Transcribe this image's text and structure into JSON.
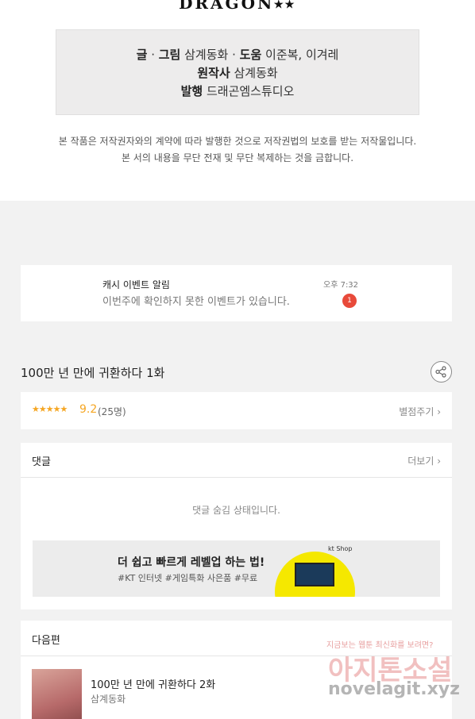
{
  "logo": "DRAGON⭑⭑",
  "credits": {
    "line1_label_a": "글",
    "sep1": " · ",
    "line1_label_b": "그림",
    "line1_name_a": " 삼계동화 · ",
    "line1_label_c": "도움",
    "line1_name_b": " 이준복, 이겨레",
    "line2_label": "원작사",
    "line2_name": " 삼계동화",
    "line3_label": "발행",
    "line3_name": " 드래곤엠스튜디오"
  },
  "notice": {
    "line1": "본 작품은 저작권자와의 계약에 따라 발행한 것으로 저작권법의 보호를 받는 저작물입니다.",
    "line2": "본 서의 내용을 무단 전재 및 무단 복제하는 것을 금합니다."
  },
  "alarm": {
    "title": "캐시 이벤트 알림",
    "desc": "이번주에 확인하지 못한 이벤트가 있습니다.",
    "time": "오후 7:32",
    "badge": "1"
  },
  "episode": {
    "title": "100만 년 만에 귀환하다 1화"
  },
  "rating": {
    "stars": "★★★★★",
    "score": "9.2",
    "count": "(25명)",
    "action": "별점주기 ›"
  },
  "comments": {
    "title": "댓글",
    "more": "더보기 ›",
    "empty": "댓글 숨김 상태입니다."
  },
  "ad": {
    "headline": "더 쉽고 빠르게 레벨업 하는 법!",
    "tags": "#KT 인터넷 #게임특화 사은품 #무료",
    "brand": "kt Shop"
  },
  "next": {
    "title": "다음편",
    "episode": "100만 년 만에 귀환하다 2화",
    "author": "삼계동화"
  },
  "watermark": {
    "small": "지금보는 웹툰 최신화를 보려면?",
    "main": "아지톤소설",
    "url": "novelagit.xyz"
  }
}
